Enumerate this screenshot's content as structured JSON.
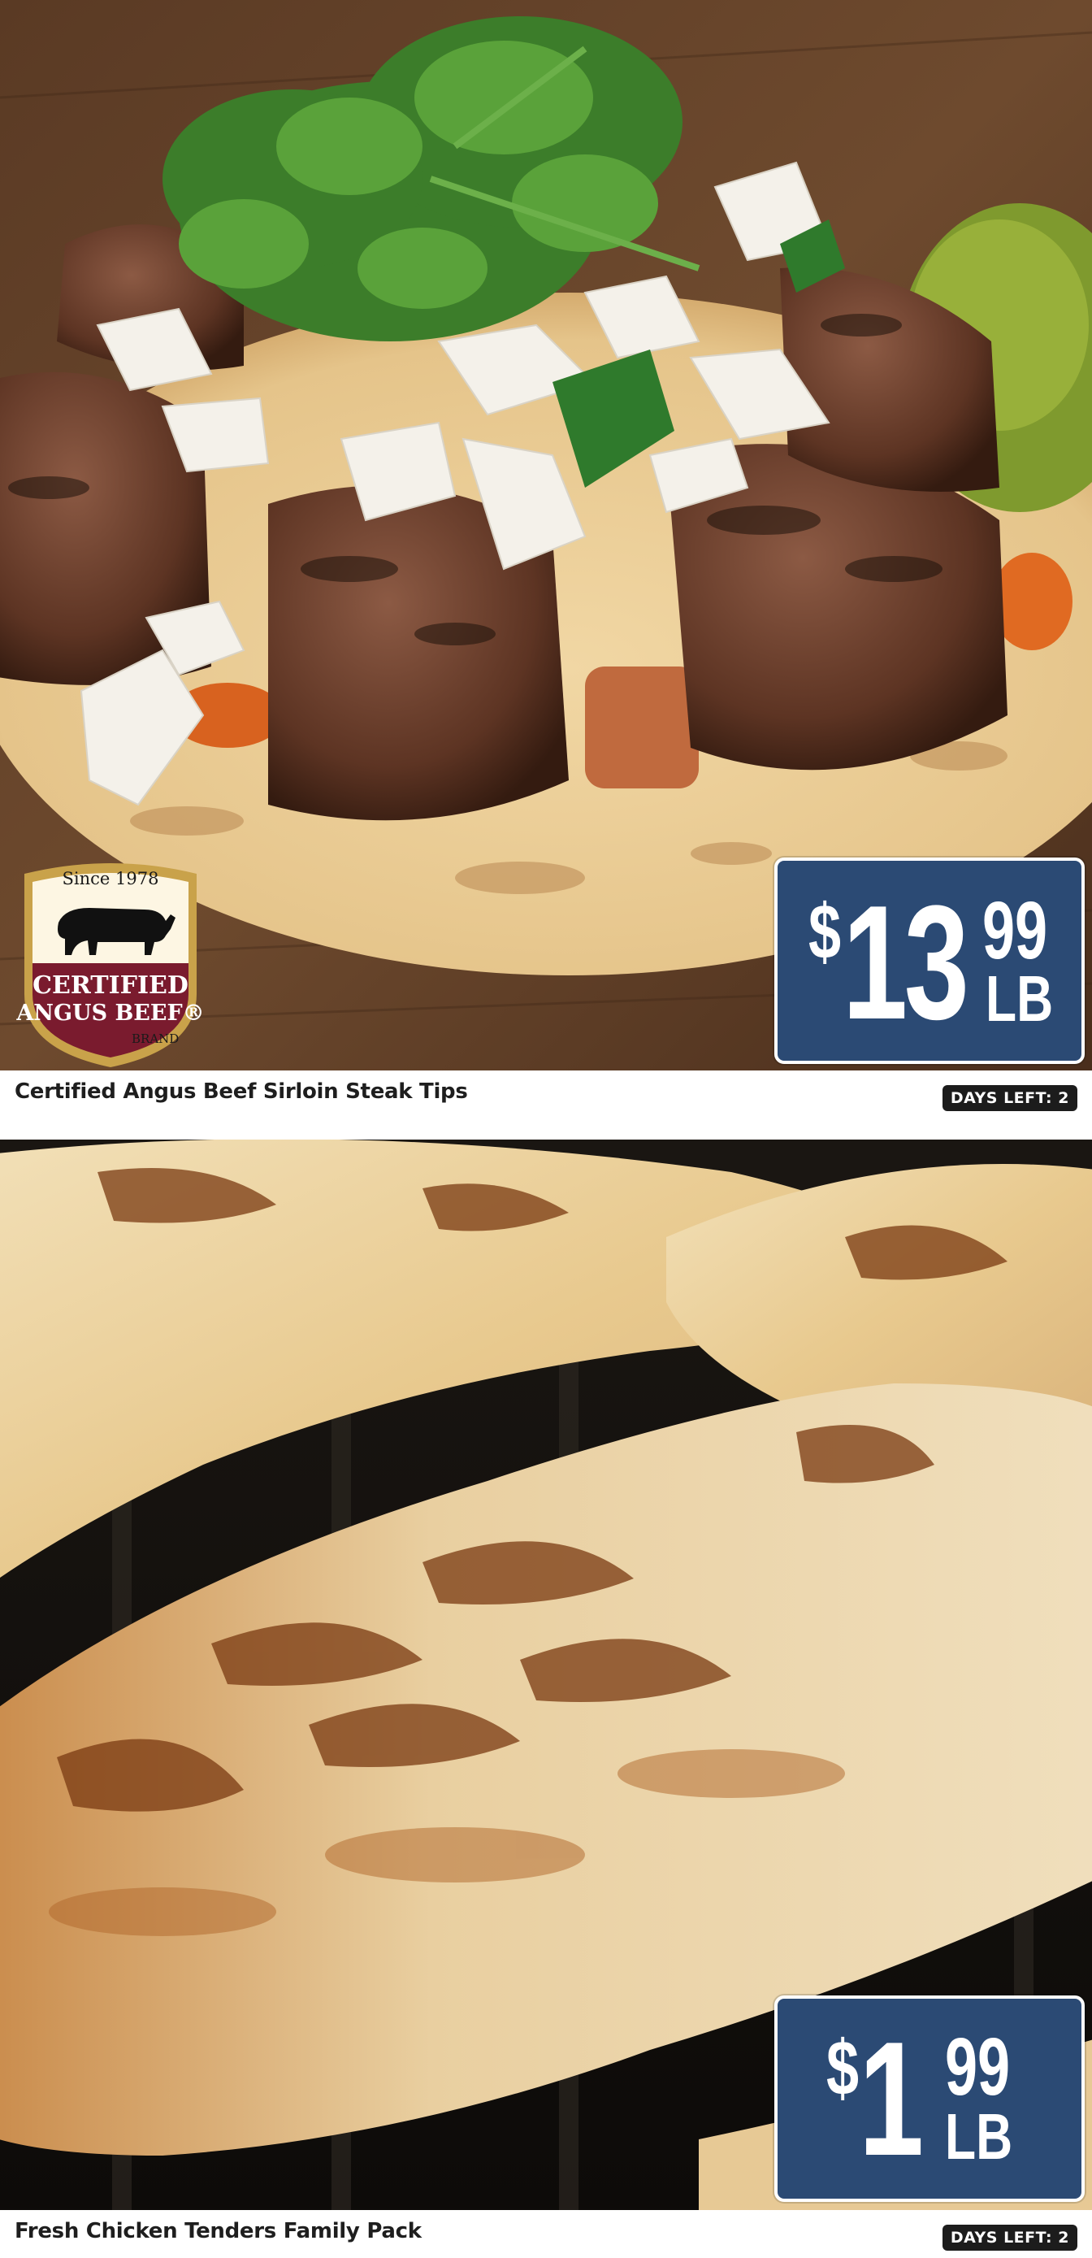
{
  "products": [
    {
      "name": "Certified Angus Beef Sirloin Steak Tips",
      "days_left": "DAYS LEFT: 2",
      "price": {
        "dollar_sign": "$",
        "whole": "13",
        "cents": "99",
        "unit": "LB"
      },
      "image": "steak-tips-taco-photo",
      "logo": {
        "since": "Since 1978",
        "line1": "CERTIFIED",
        "line2": "ANGUS BEEF®",
        "brand": "BRAND"
      }
    },
    {
      "name": "Fresh Chicken Tenders Family Pack",
      "days_left": "DAYS LEFT: 2",
      "price": {
        "dollar_sign": "$",
        "whole": "1",
        "cents": "99",
        "unit": "LB"
      },
      "image": "grilled-chicken-tenders-photo"
    }
  ],
  "colors": {
    "price_tag_bg": "#2b4a74",
    "badge_bg": "#1c1c1c",
    "logo_maroon": "#7a1b2e",
    "logo_gold": "#c9a24a"
  }
}
